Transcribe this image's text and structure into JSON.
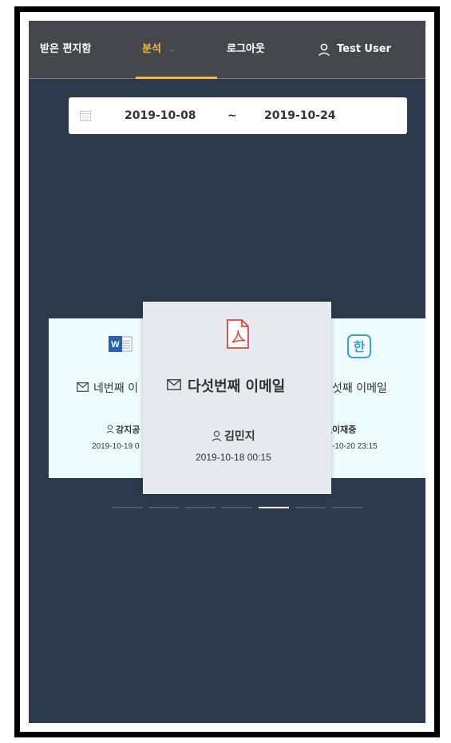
{
  "nav": {
    "inbox": "받은 편지함",
    "analysis": "분석",
    "logout": "로그아웃",
    "user": "Test User"
  },
  "date_range": {
    "start": "2019-10-08",
    "separator": "~",
    "end": "2019-10-24"
  },
  "cards": {
    "left": {
      "icon": "word-icon",
      "title": "네번째 이",
      "sender": "강지공",
      "date": "2019-10-19 0"
    },
    "center": {
      "icon": "pdf-icon",
      "title": "다섯번째 이메일",
      "sender": "김민지",
      "date": "2019-10-18 00:15"
    },
    "right": {
      "icon": "hwp-icon",
      "title": "섯째 이메일",
      "sender": "이재중",
      "date": "-10-20 23:15"
    }
  },
  "pager": {
    "count": 7,
    "active_index": 4
  },
  "colors": {
    "background": "#2d3a4b",
    "header": "#45474c",
    "accent": "#f6b93b",
    "card": "#effcfd",
    "card_active": "#e6e9ee"
  }
}
